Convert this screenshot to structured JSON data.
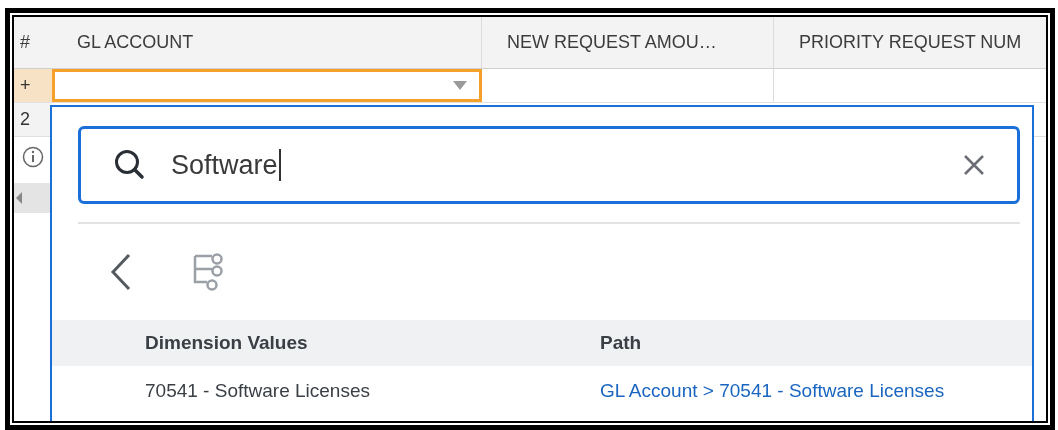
{
  "grid": {
    "columns": [
      "#",
      "GL ACCOUNT",
      "NEW REQUEST AMOU…",
      "PRIORITY REQUEST NUM"
    ],
    "rows": [
      {
        "marker": "+",
        "editing": true
      },
      {
        "marker": "2",
        "editing": false
      }
    ]
  },
  "dropdown": {
    "search": {
      "value": "Software"
    },
    "results": {
      "columns": [
        "Dimension Values",
        "Path"
      ],
      "rows": [
        {
          "value": "70541 - Software Licenses",
          "path": "GL Account > 70541 - Software Licenses"
        }
      ]
    }
  }
}
